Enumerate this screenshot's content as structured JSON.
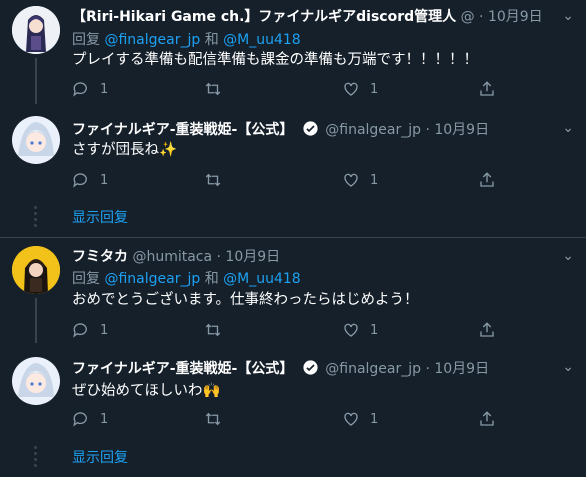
{
  "tweets": [
    {
      "name": "【Riri-Hikari Game ch.】ファイナルギアdiscord管理人",
      "meta": "@ · 10月9日",
      "reply_prefix": "回复",
      "mention1": "@finalgear_jp",
      "and": "和",
      "mention2": "@M_uu418",
      "text": "プレイする準備も配信準備も課金の準備も万端です！！！！！",
      "replies": "1",
      "likes": "1"
    },
    {
      "name": "ファイナルギア-重装戦姫-【公式】",
      "meta": "@finalgear_jp · 10月9日",
      "text": "さすが団長ね✨",
      "replies": "1",
      "likes": "1"
    },
    {
      "name": "フミタカ",
      "meta": "@humitaca · 10月9日",
      "reply_prefix": "回复",
      "mention1": "@finalgear_jp",
      "and": "和",
      "mention2": "@M_uu418",
      "text": "おめでとうございます。仕事終わったらはじめよう！",
      "replies": "1",
      "likes": "1"
    },
    {
      "name": "ファイナルギア-重装戦姫-【公式】",
      "meta": "@finalgear_jp · 10月9日",
      "text": "ぜひ始めてほしいわ🙌",
      "replies": "1",
      "likes": "1"
    }
  ],
  "show_replies_label": "显示回复",
  "colors": {
    "background": "#15202b",
    "accent": "#1da1f2",
    "muted": "#8899a6",
    "border": "#38444d"
  },
  "icons": [
    "reply-icon",
    "retweet-icon",
    "like-icon",
    "share-icon",
    "verified-badge-icon"
  ]
}
